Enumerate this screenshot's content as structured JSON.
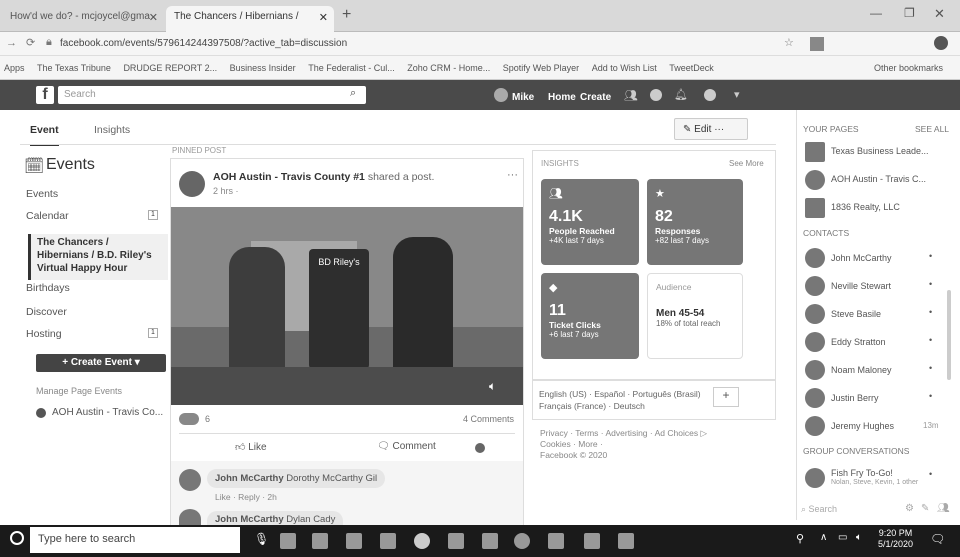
{
  "browser": {
    "tabs": [
      {
        "label": "How'd we do? - mcjoycel@gma"
      },
      {
        "label": "The Chancers / Hibernians /"
      }
    ],
    "url": "facebook.com/events/579614244397508/?active_tab=discussion",
    "bookmarks": [
      "Apps",
      "The Texas Tribune",
      "DRUDGE REPORT 2...",
      "Business Insider",
      "The Federalist - Cul...",
      "Zoho CRM - Home...",
      "Spotify Web Player",
      "Add to Wish List",
      "TweetDeck",
      "Other bookmarks"
    ]
  },
  "fb": {
    "search_placeholder": "Search",
    "user": "Mike",
    "home": "Home",
    "create": "Create"
  },
  "subnav": {
    "tab_event": "Event",
    "tab_insights": "Insights",
    "edit": "Edit",
    "more": "···"
  },
  "left": {
    "title": "Events",
    "items": [
      "Events",
      "Calendar",
      "Birthdays",
      "Discover",
      "Hosting"
    ],
    "selected": "The Chancers / Hibernians / B.D. Riley's Virtual Happy Hour",
    "create_button": "+ Create Event ▾",
    "manage_label": "Manage Page Events",
    "page_item": "AOH Austin - Travis Co..."
  },
  "post": {
    "pinned": "PINNED POST",
    "author": "AOH Austin - Travis County #1",
    "action": "shared a post.",
    "time": "2 hrs ·",
    "reactions": "6",
    "comments": "4 Comments",
    "like": "Like",
    "comment": "Comment",
    "c1_author": "John McCarthy",
    "c1_text": "Dorothy McCarthy Gil",
    "c1_meta": "Like · Reply · 2h",
    "c2_author": "John McCarthy",
    "c2_text": "Dylan Cady",
    "sign": "BD Riley's"
  },
  "insights": {
    "title": "INSIGHTS",
    "see_more": "See More",
    "reached_value": "4.1K",
    "reached_label": "People Reached",
    "reached_sub": "+4K last 7 days",
    "resp_value": "82",
    "resp_label": "Responses",
    "resp_sub": "+82 last 7 days",
    "ticket_value": "11",
    "ticket_label": "Ticket Clicks",
    "ticket_sub": "+6 last 7 days",
    "aud_title": "Audience",
    "aud_value": "Men 45-54",
    "aud_sub": "18% of total reach"
  },
  "languages": {
    "line1": "English (US) · Español · Português (Brasil)",
    "line2": "Français (France) · Deutsch"
  },
  "footer": {
    "line1": "Privacy · Terms · Advertising · Ad Choices ▷",
    "line2": "Cookies · More ·",
    "line3": "Facebook © 2020"
  },
  "right": {
    "pages_title": "YOUR PAGES",
    "see_all": "SEE ALL",
    "pages": [
      "Texas Business Leade...",
      "AOH Austin - Travis C...",
      "1836 Realty, LLC"
    ],
    "contacts_title": "CONTACTS",
    "contacts": [
      "John McCarthy",
      "Neville Stewart",
      "Steve Basile",
      "Eddy Stratton",
      "Noam Maloney",
      "Justin Berry",
      "Jeremy Hughes"
    ],
    "jeremy_time": "13m",
    "group_title": "GROUP CONVERSATIONS",
    "group_name": "Fish Fry To-Go!",
    "group_members": "Nolan, Steve, Kevin, 1 other",
    "search": "Search"
  },
  "taskbar": {
    "search": "Type here to search",
    "time": "9:20 PM",
    "date": "5/1/2020"
  }
}
